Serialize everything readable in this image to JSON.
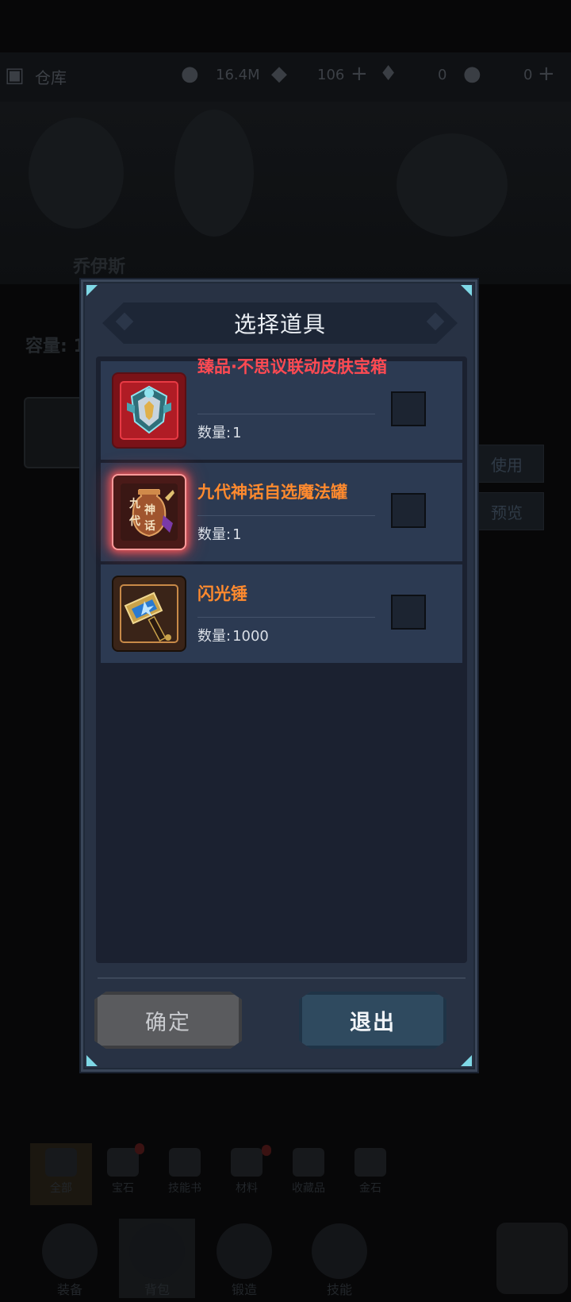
{
  "background": {
    "topbar": {
      "title": "仓库",
      "gold": "16.4M",
      "gems": "106",
      "stat3": "0",
      "stat4": "0"
    },
    "hero_name": "乔伊斯",
    "capacity_label": "容量: 1",
    "side_buttons": [
      "使用",
      "预览"
    ],
    "tabs": [
      "全部",
      "宝石",
      "技能书",
      "材料",
      "收藏品",
      "金石"
    ],
    "nav": [
      "装备",
      "背包",
      "锻造",
      "技能"
    ]
  },
  "dialog": {
    "title": "选择道具",
    "qty_label": "数量:",
    "items": [
      {
        "name": "臻品·不思议联动皮肤宝箱",
        "name_color": "#ff4a52",
        "qty": "1",
        "icon": "skin-chest-icon",
        "checked": false
      },
      {
        "name": "九代神话自选魔法罐",
        "name_color": "#ff8a2e",
        "qty": "1",
        "icon": "myth-jar-icon",
        "icon_text": [
          "九",
          "代",
          "神",
          "话"
        ],
        "checked": false
      },
      {
        "name": "闪光锤",
        "name_color": "#ff8a2e",
        "qty": "1000",
        "icon": "flash-hammer-icon",
        "checked": false
      }
    ],
    "confirm_label": "确定",
    "exit_label": "退出"
  }
}
